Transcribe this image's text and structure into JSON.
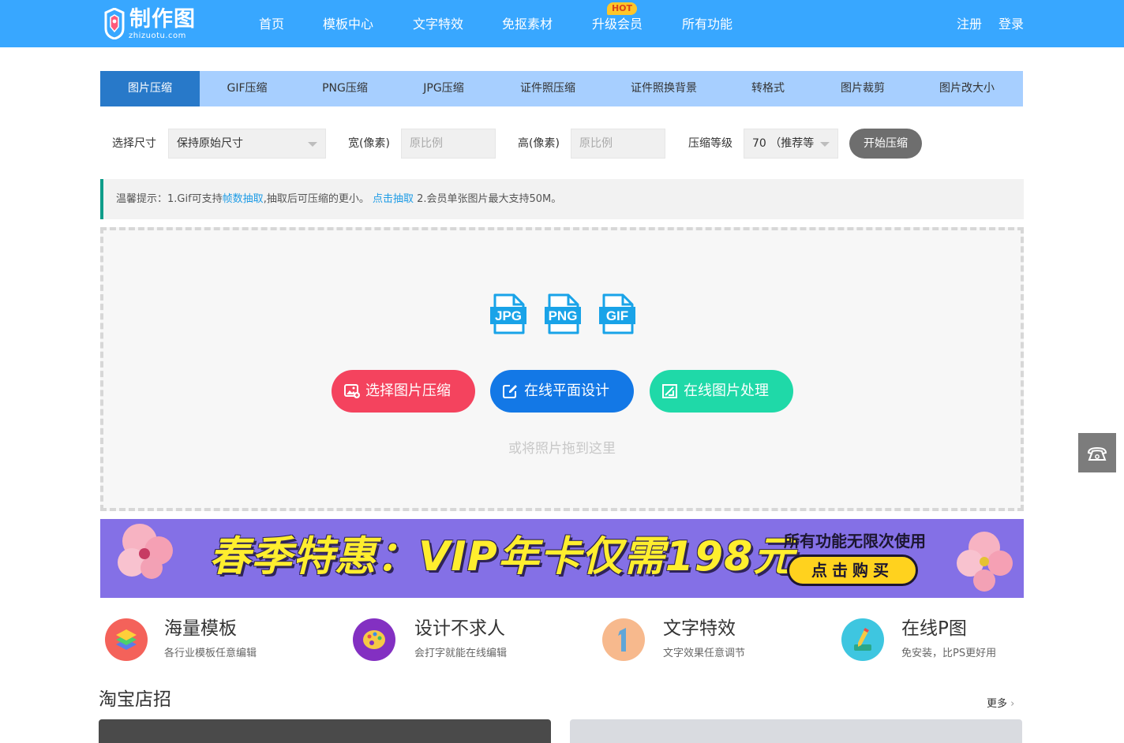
{
  "header": {
    "logo_text": "制作图",
    "logo_sub": "zhizuotu.com",
    "nav": [
      "首页",
      "模板中心",
      "文字特效",
      "免抠素材",
      "升级会员",
      "所有功能"
    ],
    "hot_badge": "HOT",
    "register": "注册",
    "login": "登录"
  },
  "tabs": [
    "图片压缩",
    "GIF压缩",
    "PNG压缩",
    "JPG压缩",
    "证件照压缩",
    "证件照换背景",
    "转格式",
    "图片裁剪",
    "图片改大小"
  ],
  "options": {
    "size_label": "选择尺寸",
    "size_value": "保持原始尺寸",
    "width_label": "宽(像素)",
    "width_placeholder": "原比例",
    "height_label": "高(像素)",
    "height_placeholder": "原比例",
    "level_label": "压缩等级",
    "level_value": "70 （推荐等",
    "start_button": "开始压缩"
  },
  "tip": {
    "prefix": "温馨提示：1.Gif可支持",
    "link1": "帧数抽取",
    "middle": ",抽取后可压缩的更小。 ",
    "link2": "点击抽取",
    "suffix": " 2.会员单张图片最大支持50M。"
  },
  "dropzone": {
    "formats": [
      "JPG",
      "PNG",
      "GIF"
    ],
    "buttons": [
      "选择图片压缩",
      "在线平面设计",
      "在线图片处理"
    ],
    "hint": "或将照片拖到这里"
  },
  "banner": {
    "main": "春季特惠：VIP年卡仅需198元",
    "side": "所有功能无限次使用",
    "buy": "点击购买"
  },
  "features": [
    {
      "title": "海量模板",
      "desc": "各行业模板任意编辑"
    },
    {
      "title": "设计不求人",
      "desc": "会打字就能在线编辑"
    },
    {
      "title": "文字特效",
      "desc": "文字效果任意调节"
    },
    {
      "title": "在线P图",
      "desc": "免安装，比PS更好用"
    }
  ],
  "section": {
    "title": "淘宝店招",
    "more": "更多"
  },
  "colors": {
    "header_bg": "#38a7ff",
    "tab_active": "#2879c9",
    "btn_red": "#f4435e",
    "btn_blue": "#1378e6",
    "btn_green": "#1fd9a8"
  }
}
